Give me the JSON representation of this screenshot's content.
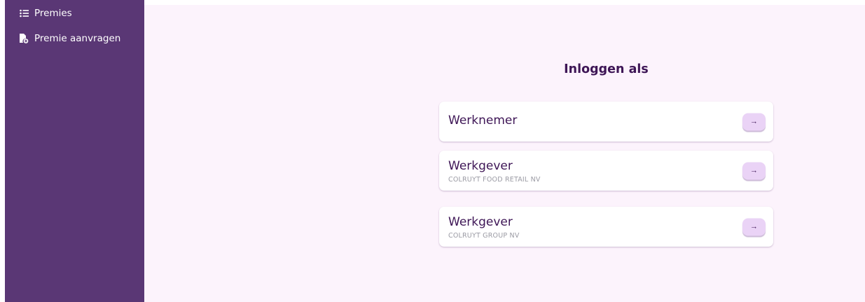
{
  "sidebar": {
    "items": [
      {
        "label": "Premies",
        "icon": "list-icon"
      },
      {
        "label": "Premie aanvragen",
        "icon": "file-add-icon"
      }
    ]
  },
  "main": {
    "heading": "Inloggen als",
    "options": [
      {
        "title": "Werknemer",
        "subtitle": ""
      },
      {
        "title": "Werkgever",
        "subtitle": "COLRUYT FOOD RETAIL NV"
      },
      {
        "title": "Werkgever",
        "subtitle": "COLRUYT GROUP NV"
      }
    ],
    "arrow_glyph": "→"
  },
  "colors": {
    "sidebar": "#5a3775",
    "main_bg": "#fcf3fc",
    "text_dark": "#3e1656",
    "button_bg": "#ead3f6"
  }
}
